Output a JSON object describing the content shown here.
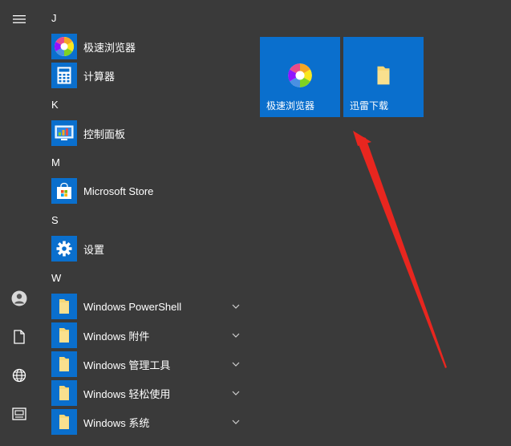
{
  "rail": {
    "items": [
      {
        "name": "hamburger-menu-icon"
      },
      {
        "name": "user-account-icon"
      },
      {
        "name": "document-icon"
      },
      {
        "name": "globe-icon"
      },
      {
        "name": "gallery-icon"
      }
    ]
  },
  "app_list": {
    "groups": [
      {
        "letter": "J",
        "apps": [
          {
            "label": "极速浏览器",
            "icon": "colorful-browser-icon"
          },
          {
            "label": "计算器",
            "icon": "calculator-icon"
          }
        ]
      },
      {
        "letter": "K",
        "apps": [
          {
            "label": "控制面板",
            "icon": "control-panel-icon"
          }
        ]
      },
      {
        "letter": "M",
        "apps": [
          {
            "label": "Microsoft Store",
            "icon": "store-bag-icon"
          }
        ]
      },
      {
        "letter": "S",
        "apps": [
          {
            "label": "设置",
            "icon": "gear-icon"
          }
        ]
      },
      {
        "letter": "W",
        "apps": [
          {
            "label": "Windows PowerShell",
            "icon": "folder-icon",
            "expandable": true
          },
          {
            "label": "Windows 附件",
            "icon": "folder-icon",
            "expandable": true
          },
          {
            "label": "Windows 管理工具",
            "icon": "folder-icon",
            "expandable": true
          },
          {
            "label": "Windows 轻松使用",
            "icon": "folder-icon",
            "expandable": true
          },
          {
            "label": "Windows 系统",
            "icon": "folder-icon",
            "expandable": true
          }
        ]
      }
    ]
  },
  "tiles": [
    {
      "label": "极速浏览器",
      "icon": "colorful-browser-icon"
    },
    {
      "label": "迅雷下载",
      "icon": "folder-icon"
    }
  ],
  "colors": {
    "background": "#3a3a3a",
    "accent": "#0a6fcd",
    "annotation_arrow": "#e8261f",
    "folder": "#f6d776"
  }
}
